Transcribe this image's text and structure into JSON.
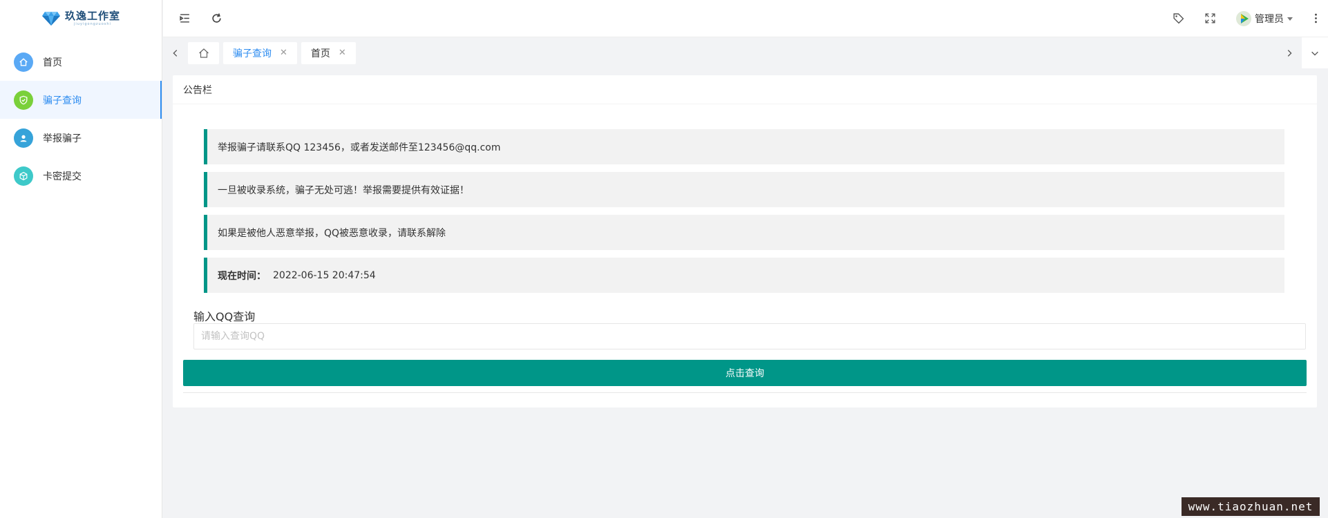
{
  "brand": {
    "title": "玖逸工作室",
    "subtitle": "jiuyigongzuoshi"
  },
  "sidebar": {
    "items": [
      {
        "label": "首页",
        "icon": "home-icon",
        "color": "#5aa9f5",
        "active": false
      },
      {
        "label": "骗子查询",
        "icon": "shield-check-icon",
        "color": "#7ad03a",
        "active": true
      },
      {
        "label": "举报骗子",
        "icon": "user-report-icon",
        "color": "#36a3d9",
        "active": false
      },
      {
        "label": "卡密提交",
        "icon": "cube-icon",
        "color": "#3ec9c9",
        "active": false
      }
    ]
  },
  "header": {
    "user_name": "管理员"
  },
  "tabs": [
    {
      "label": "骗子查询",
      "active": true
    },
    {
      "label": "首页",
      "active": false
    }
  ],
  "card": {
    "title": "公告栏",
    "notices": [
      "举报骗子请联系QQ 123456，或者发送邮件至123456@qq.com",
      "一旦被收录系统，骗子无处可逃！举报需要提供有效证据！",
      "如果是被他人恶意举报，QQ被恶意收录，请联系解除"
    ],
    "time_label": "现在时间：",
    "time_value": "2022-06-15 20:47:54",
    "query_label": "输入QQ查询",
    "query_placeholder": "请输入查询QQ",
    "query_value": "",
    "query_button": "点击查询"
  },
  "watermark": "www.tiaozhuan.net",
  "colors": {
    "accent": "#009688",
    "active_blue": "#2d8cf0",
    "background": "#f2f3f5"
  }
}
